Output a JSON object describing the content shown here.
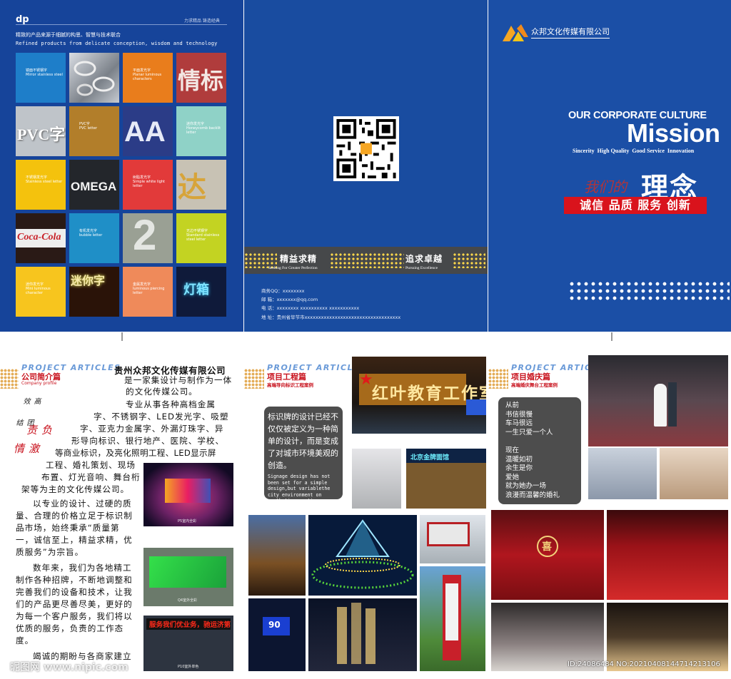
{
  "panel1": {
    "brand": "dp",
    "tagline_right": "力求精品  铸造经典",
    "cn_slogan": "精致的产品来源于细腻的构思、智慧与技术联合",
    "en_slogan": "Refined products from delicate conception, wisdom and technology",
    "tiles": [
      {
        "label": "镜面不锈钢字\nMirror stainless steel"
      },
      {
        "label": "TOYOTA"
      },
      {
        "label": "平面发光字\nPlanar luminous characters"
      },
      {
        "label": "情标"
      },
      {
        "label": "PVC字"
      },
      {
        "label": "PVC字\nPVC letter"
      },
      {
        "label": "AA"
      },
      {
        "label": "迷你发光字\nHoneycomb backlit letter"
      },
      {
        "label": "不锈钢发光字\nStainless steel letter"
      },
      {
        "label": "OMEGA"
      },
      {
        "label": "树脂发光字\nSimple white light letter"
      },
      {
        "label": "达"
      },
      {
        "label": "Coca-Cola"
      },
      {
        "label": "有机发光字\nbubble letter"
      },
      {
        "label": "2"
      },
      {
        "label": "无边不锈钢字\nStandard stainless steel letter"
      },
      {
        "label": "迷你发光字\nMini luminous character"
      },
      {
        "label": "迷你字"
      },
      {
        "label": "金属发光字\nluminous piercing letter"
      },
      {
        "label": "灯箱"
      }
    ]
  },
  "panel2": {
    "banner_left_cn": "精益求精",
    "banner_left_en": "Seeking For Greater Perfection",
    "banner_right_cn": "追求卓越",
    "banner_right_en": "Pursuing Excellence",
    "contacts": [
      "商务QQ：xxxxxxxx",
      "邮    箱：xxxxxxx@qq.com",
      "电    话：xxxxxxxx  xxxxxxxxxx  xxxxxxxxxxx",
      "地    址：贵州省毕节市xxxxxxxxxxxxxxxxxxxxxxxxxxxxxxxxxxx"
    ]
  },
  "panel3": {
    "company": "众邦文化传媒有限公司",
    "culture": "OUR CORPORATE CULTURE",
    "mission": "Mission",
    "values_en": "Sincerity  High Quality  Good Service  Innovation",
    "our": "我们的",
    "idea": "理念",
    "values_cn": "诚信 品质 服务 创新"
  },
  "page4": {
    "pa": "PROJECT ARTICLES",
    "section": "公司简介篇",
    "section_sub": "Company profile",
    "title": "贵州众邦文化传媒有限公司",
    "vertical_words": [
      "高效",
      "团结",
      "负责",
      "激情"
    ],
    "lines": [
      "是一家集设计与制作为一体",
      "的文化传媒公司。",
      "专业从事各种高档金属",
      "字、不锈钢字、LED发光字、吸塑",
      "字、亚克力金属字、外漏灯珠字、异",
      "形导向标识、银行地产、医院、学校、",
      "等商业标识，及亮化照明工程、LED显示屏",
      "工程、婚礼策划、现场",
      "布置、灯光音响、舞台桁",
      "架等为主的文化传媒公司。",
      "以专业的设计、过硬的质",
      "量、合理的价格立足于标识制",
      "品市场，始终秉承“质量第",
      "一，诚信至上，精益求精，优",
      "质服务”为宗旨。",
      "数年来，我们为各地精工",
      "制作各种招牌，不断地调整和",
      "完善我们的设备和技术，让我",
      "们的产品更尽善尽美，更好的",
      "为每一个客户服务，我们将以",
      "优质的服务，负责的工作态",
      "度。",
      "竭诚的期盼与各商家建立"
    ],
    "screen_text": "服务我们优业务，驰运济第",
    "captions": [
      "P5室内全彩",
      "Q4室外全彩",
      "P10室外单色"
    ]
  },
  "page5": {
    "pa": "PROJECT ARTICLES",
    "section": "项目工程篇",
    "sub": "高端导向标识工程案例",
    "box_cn": "标识牌的设计已经不仅仅被定义为一种简单的设计，而是变成了对城市环境美观的创造。",
    "box_en": "Signage design has not been set for a simple design,but variablethe city environment on aesthetic creation.",
    "shop_sign": "红叶教育工作室",
    "shop_sign2": "北京金牌面馆",
    "blue_sign": "90"
  },
  "page6": {
    "pa": "PROJECT ARTICLES",
    "section": "项目婚庆篇",
    "sub": "高端婚庆舞台工程案例",
    "poem": [
      "从前",
      "书信很慢",
      "车马很远",
      "一生只爱一个人",
      "",
      "现在",
      "温暖如初",
      "余生是你",
      "爱她",
      "就为她办一场",
      "浪漫而温馨的婚礼"
    ],
    "wedding_sign": "喜"
  },
  "footer": {
    "watermark": "昵图网 www.nipic.com",
    "id_text": "ID:24086484 NO:20210408144714213106"
  }
}
